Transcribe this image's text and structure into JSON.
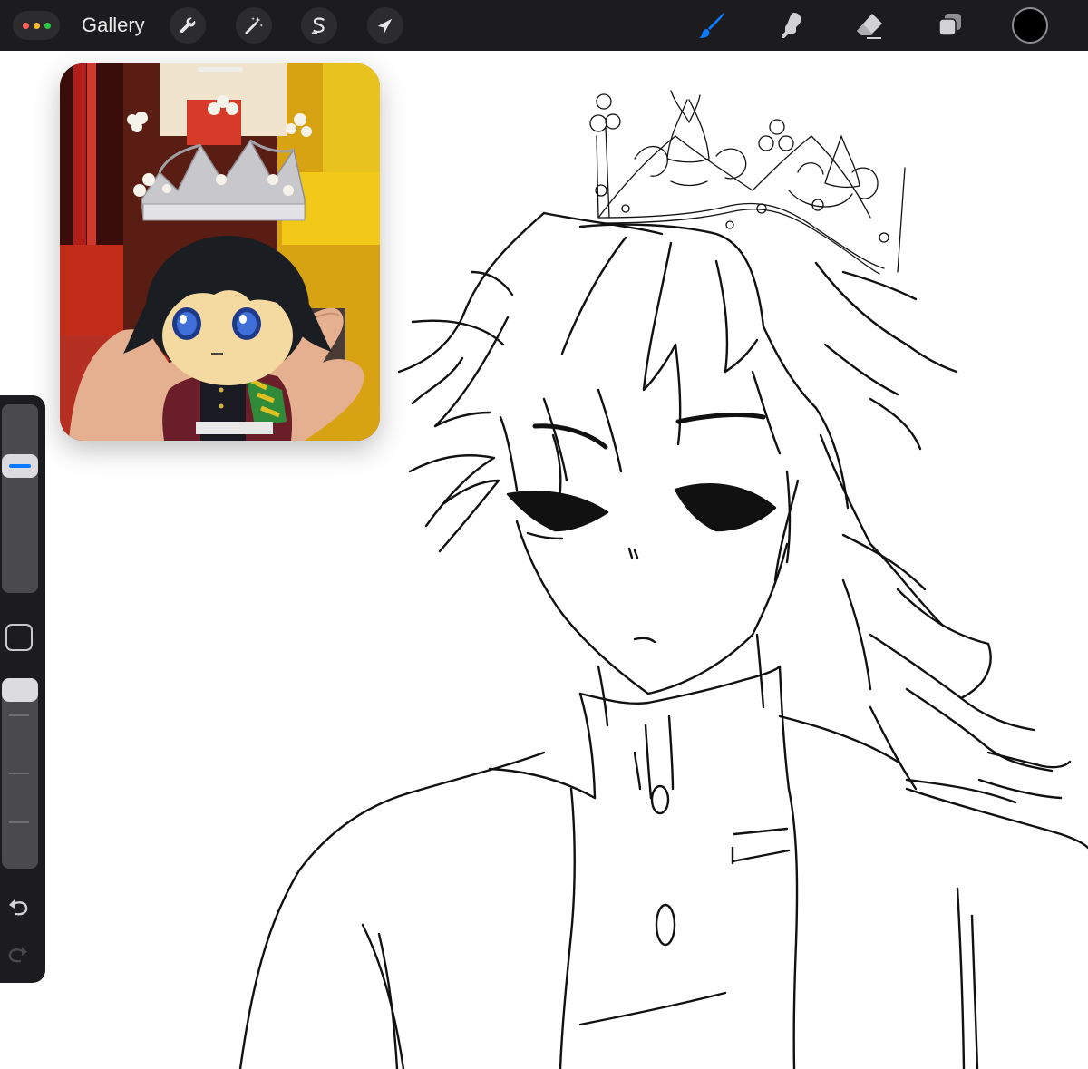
{
  "toolbar": {
    "window_dots_colors": [
      "#ff5f57",
      "#febc2e",
      "#28c840"
    ],
    "gallery_label": "Gallery",
    "left_tools": [
      "wrench-icon",
      "magic-wand-icon",
      "selection-s-icon",
      "move-arrow-icon"
    ],
    "right_tools": [
      "brush-icon",
      "smudge-icon",
      "eraser-icon",
      "layers-icon"
    ],
    "active_tool": "brush-icon",
    "active_color": "#0a7aff",
    "current_color": "#000000"
  },
  "sidebar": {
    "brush_size_level": 0.3,
    "opacity_level": 0.0,
    "controls": [
      "brush-size-slider",
      "modify-button",
      "opacity-slider",
      "undo-icon",
      "redo-icon"
    ]
  },
  "reference": {
    "label": "reference-image"
  }
}
